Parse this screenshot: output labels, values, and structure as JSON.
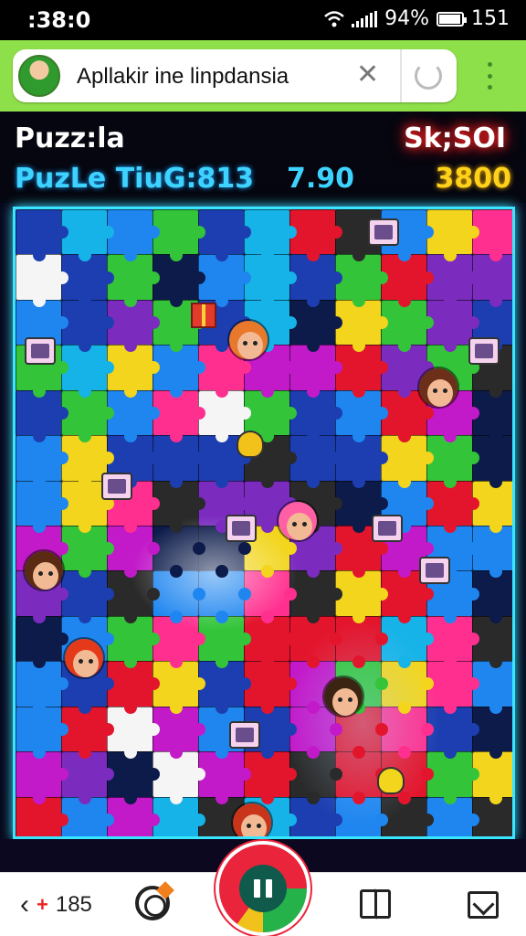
{
  "status_bar": {
    "time": ":38:0",
    "battery_text": "94%",
    "extra": "151",
    "battery_level_percent": 94
  },
  "url_bar": {
    "text": "Apllakir ine linpdansia"
  },
  "game": {
    "title": "Puzz:la",
    "score_label": "Sk;SOI",
    "timer_label": "PuzLe TiuG:813",
    "mid_value": "7.90",
    "score_value": "3800"
  },
  "bottom_nav": {
    "back_count": "185"
  },
  "colors": {
    "accent_green": "#8ee04a",
    "board_border": "#39e6ff",
    "score_yellow": "#ffd21a",
    "timer_cyan": "#3ed3ff",
    "pause_red": "#e9243b"
  },
  "icons": [
    "wifi-icon",
    "signal-icon",
    "battery-icon",
    "close-icon",
    "reload-icon",
    "menu-icon",
    "back-icon",
    "target-icon",
    "pause-icon",
    "book-icon",
    "mail-icon"
  ]
}
